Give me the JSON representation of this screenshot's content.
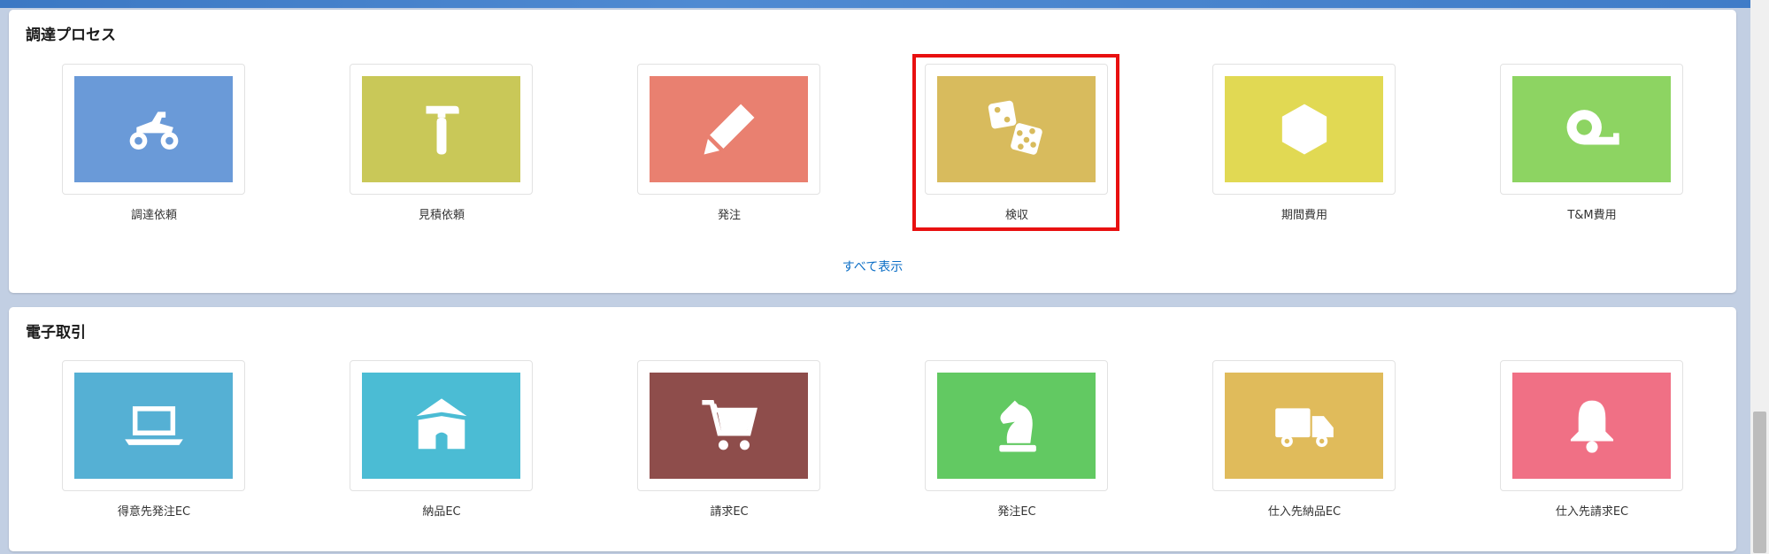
{
  "process_section": {
    "title": "調達プロセス",
    "tiles": [
      {
        "label": "調達依頼",
        "color": "#6a9ad8",
        "icon": "atv-icon"
      },
      {
        "label": "見積依頼",
        "color": "#c9c858",
        "icon": "hammer-icon"
      },
      {
        "label": "発注",
        "color": "#e98070",
        "icon": "pencil-icon"
      },
      {
        "label": "検収",
        "color": "#d8bb5d",
        "icon": "dice-icon"
      },
      {
        "label": "期間費用",
        "color": "#e1d953",
        "icon": "hexagon-icon"
      },
      {
        "label": "T&M費用",
        "color": "#8dd462",
        "icon": "tape-measure-icon"
      }
    ],
    "show_all": "すべて表示"
  },
  "ec_section": {
    "title": "電子取引",
    "tiles": [
      {
        "label": "得意先発注EC",
        "color": "#55b0d4",
        "icon": "laptop-icon"
      },
      {
        "label": "納品EC",
        "color": "#4bbcd4",
        "icon": "tent-icon"
      },
      {
        "label": "請求EC",
        "color": "#8e4d4b",
        "icon": "cart-icon"
      },
      {
        "label": "発注EC",
        "color": "#62c962",
        "icon": "chess-knight-icon"
      },
      {
        "label": "仕入先納品EC",
        "color": "#e0bb5b",
        "icon": "truck-icon"
      },
      {
        "label": "仕入先請求EC",
        "color": "#f07085",
        "icon": "bell-icon"
      }
    ]
  }
}
